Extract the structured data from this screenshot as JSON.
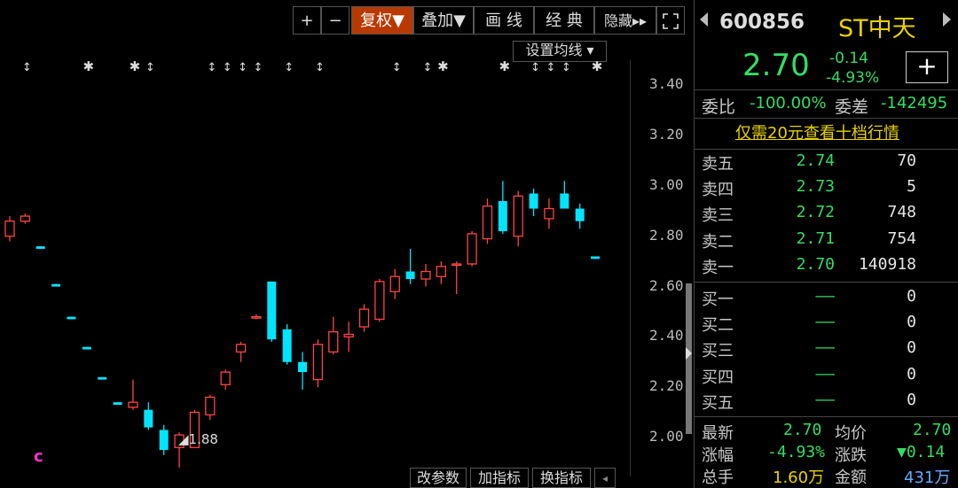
{
  "toolbar": {
    "plus": "+",
    "minus": "−",
    "fuquan": "复权▼",
    "diejia": "叠加▼",
    "huaxian": "画 线",
    "jingdian": "经 典",
    "yincang": "隐藏▸▸",
    "fullscreen_icon": "expand-icon"
  },
  "ma_button": "设置均线 ▾",
  "y_ticks": [
    "3.40",
    "3.20",
    "3.00",
    "2.80",
    "2.60",
    "2.40",
    "2.20",
    "2.00"
  ],
  "low_label": "1.88",
  "bottom_buttons": [
    "改参数",
    "加指标",
    "换指标"
  ],
  "marker_c": "c",
  "stock": {
    "code": "600856",
    "name": "ST中天",
    "price": "2.70",
    "change": "-0.14",
    "change_pct": "-4.93%",
    "add": "+"
  },
  "weibi": {
    "label1": "委比",
    "value1": "-100.00%",
    "label2": "委差",
    "value2": "-142495"
  },
  "promo": "仅需20元查看十档行情",
  "asks": [
    {
      "label": "卖五",
      "price": "2.74",
      "vol": "70"
    },
    {
      "label": "卖四",
      "price": "2.73",
      "vol": "5"
    },
    {
      "label": "卖三",
      "price": "2.72",
      "vol": "748"
    },
    {
      "label": "卖二",
      "price": "2.71",
      "vol": "754"
    },
    {
      "label": "卖一",
      "price": "2.70",
      "vol": "140918"
    }
  ],
  "bids": [
    {
      "label": "买一",
      "price": "——",
      "vol": "0"
    },
    {
      "label": "买二",
      "price": "——",
      "vol": "0"
    },
    {
      "label": "买三",
      "price": "——",
      "vol": "0"
    },
    {
      "label": "买四",
      "price": "——",
      "vol": "0"
    },
    {
      "label": "买五",
      "price": "——",
      "vol": "0"
    }
  ],
  "stats": {
    "zuixin_label": "最新",
    "zuixin": "2.70",
    "junjia_label": "均价",
    "junjia": "2.70",
    "zhangfu_label": "涨幅",
    "zhangfu": "-4.93%",
    "zhangdie_label": "涨跌",
    "zhangdie": "▼0.14",
    "zongshou_label": "总手",
    "zongshou": "1.60万",
    "jine_label": "金额",
    "jine": "431万"
  },
  "chart_data": {
    "type": "candlestick",
    "colors": {
      "up": "#ff4444",
      "down": "#00e5ff"
    },
    "ylim": [
      1.88,
      3.5
    ],
    "y_ticks": [
      3.4,
      3.2,
      3.0,
      2.8,
      2.6,
      2.4,
      2.2,
      2.0
    ],
    "candles": [
      {
        "o": 2.8,
        "h": 2.88,
        "l": 2.78,
        "c": 2.86
      },
      {
        "o": 2.86,
        "h": 2.89,
        "l": 2.85,
        "c": 2.88
      },
      {
        "o": 2.76,
        "h": 2.76,
        "l": 2.75,
        "c": 2.75
      },
      {
        "o": 2.61,
        "h": 2.61,
        "l": 2.6,
        "c": 2.6
      },
      {
        "o": 2.48,
        "h": 2.48,
        "l": 2.47,
        "c": 2.47
      },
      {
        "o": 2.36,
        "h": 2.36,
        "l": 2.35,
        "c": 2.35
      },
      {
        "o": 2.24,
        "h": 2.24,
        "l": 2.23,
        "c": 2.23
      },
      {
        "o": 2.14,
        "h": 2.14,
        "l": 2.13,
        "c": 2.13
      },
      {
        "o": 2.12,
        "h": 2.23,
        "l": 2.11,
        "c": 2.14
      },
      {
        "o": 2.11,
        "h": 2.14,
        "l": 2.03,
        "c": 2.04
      },
      {
        "o": 2.03,
        "h": 2.05,
        "l": 1.93,
        "c": 1.95
      },
      {
        "o": 1.96,
        "h": 2.02,
        "l": 1.88,
        "c": 2.01
      },
      {
        "o": 1.96,
        "h": 2.11,
        "l": 1.96,
        "c": 2.1
      },
      {
        "o": 2.09,
        "h": 2.17,
        "l": 2.07,
        "c": 2.16
      },
      {
        "o": 2.21,
        "h": 2.27,
        "l": 2.19,
        "c": 2.26
      },
      {
        "o": 2.34,
        "h": 2.38,
        "l": 2.3,
        "c": 2.37
      },
      {
        "o": 2.48,
        "h": 2.49,
        "l": 2.47,
        "c": 2.48
      },
      {
        "o": 2.62,
        "h": 2.62,
        "l": 2.38,
        "c": 2.39
      },
      {
        "o": 2.43,
        "h": 2.45,
        "l": 2.29,
        "c": 2.3
      },
      {
        "o": 2.3,
        "h": 2.34,
        "l": 2.19,
        "c": 2.26
      },
      {
        "o": 2.23,
        "h": 2.39,
        "l": 2.2,
        "c": 2.37
      },
      {
        "o": 2.34,
        "h": 2.48,
        "l": 2.33,
        "c": 2.42
      },
      {
        "o": 2.4,
        "h": 2.46,
        "l": 2.34,
        "c": 2.41
      },
      {
        "o": 2.44,
        "h": 2.53,
        "l": 2.42,
        "c": 2.51
      },
      {
        "o": 2.47,
        "h": 2.63,
        "l": 2.46,
        "c": 2.62
      },
      {
        "o": 2.58,
        "h": 2.67,
        "l": 2.55,
        "c": 2.64
      },
      {
        "o": 2.66,
        "h": 2.75,
        "l": 2.61,
        "c": 2.63
      },
      {
        "o": 2.63,
        "h": 2.69,
        "l": 2.6,
        "c": 2.66
      },
      {
        "o": 2.64,
        "h": 2.7,
        "l": 2.61,
        "c": 2.68
      },
      {
        "o": 2.69,
        "h": 2.7,
        "l": 2.57,
        "c": 2.69
      },
      {
        "o": 2.69,
        "h": 2.82,
        "l": 2.68,
        "c": 2.81
      },
      {
        "o": 2.79,
        "h": 2.95,
        "l": 2.77,
        "c": 2.92
      },
      {
        "o": 2.94,
        "h": 3.02,
        "l": 2.81,
        "c": 2.82
      },
      {
        "o": 2.8,
        "h": 2.98,
        "l": 2.76,
        "c": 2.96
      },
      {
        "o": 2.97,
        "h": 2.99,
        "l": 2.88,
        "c": 2.91
      },
      {
        "o": 2.87,
        "h": 2.95,
        "l": 2.83,
        "c": 2.91
      },
      {
        "o": 2.97,
        "h": 3.02,
        "l": 2.92,
        "c": 2.91
      },
      {
        "o": 2.91,
        "h": 2.93,
        "l": 2.83,
        "c": 2.86
      },
      {
        "o": 2.72,
        "h": 2.72,
        "l": 2.71,
        "c": 2.71
      }
    ],
    "star_positions": [
      1,
      5,
      8,
      9,
      13,
      14,
      15,
      16,
      18,
      20,
      25,
      27,
      28,
      32,
      34,
      35,
      36,
      38
    ],
    "star_types": [
      "ud",
      "x",
      "x",
      "ud",
      "ud",
      "ud",
      "ud",
      "ud",
      "ud",
      "ud",
      "ud",
      "ud",
      "x",
      "x",
      "ud",
      "ud",
      "ud",
      "x"
    ]
  }
}
